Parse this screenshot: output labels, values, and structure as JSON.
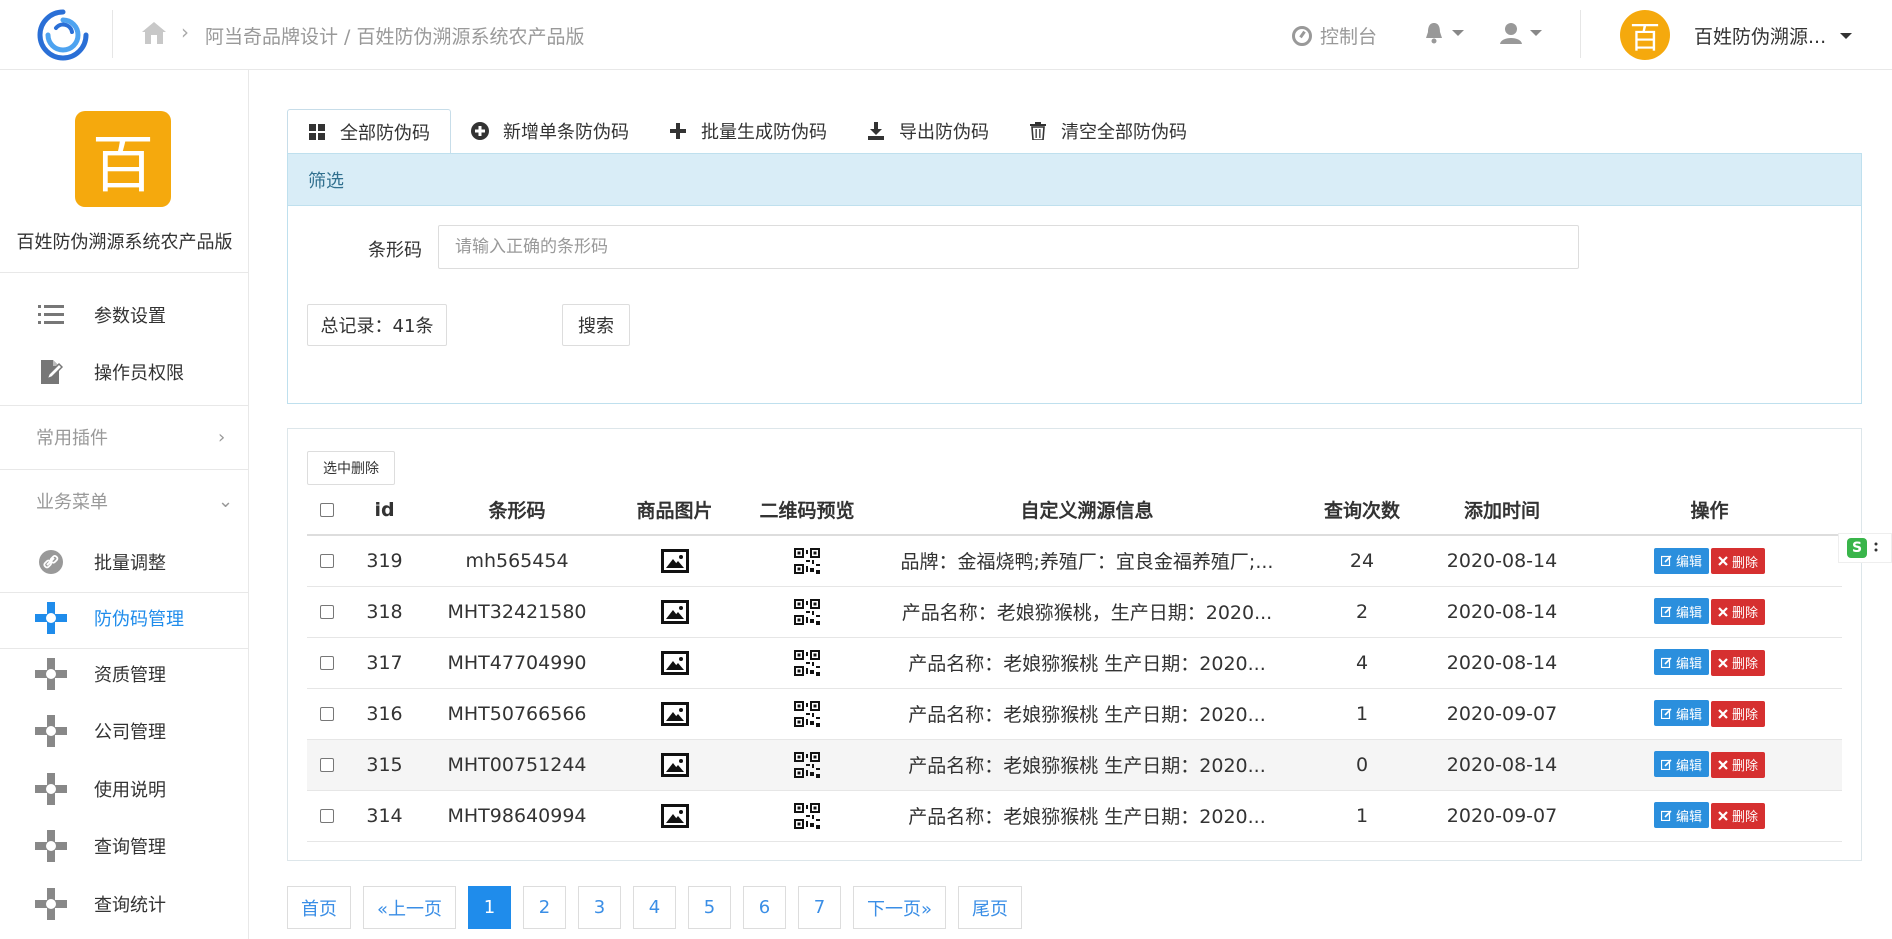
{
  "header": {
    "breadcrumb": "阿当奇品牌设计 / 百姓防伪溯源系统农产品版",
    "console_label": "控制台",
    "user_name": "百姓防伪溯源...",
    "avatar_char": "百"
  },
  "sidebar": {
    "brand_char": "百",
    "brand_name": "百姓防伪溯源系统农产品版",
    "top_items": [
      {
        "label": "参数设置",
        "icon": "list-icon"
      },
      {
        "label": "操作员权限",
        "icon": "edit-doc-icon"
      }
    ],
    "sections": [
      {
        "label": "常用插件",
        "chevron": ">"
      },
      {
        "label": "业务菜单",
        "chevron": "∨"
      }
    ],
    "business_items": [
      {
        "label": "批量调整",
        "icon": "link-icon",
        "active": false
      },
      {
        "label": "防伪码管理",
        "icon": "gear-icon",
        "active": true
      },
      {
        "label": "资质管理",
        "icon": "gear-icon",
        "active": false
      },
      {
        "label": "公司管理",
        "icon": "gear-icon",
        "active": false
      },
      {
        "label": "使用说明",
        "icon": "gear-icon",
        "active": false
      },
      {
        "label": "查询管理",
        "icon": "gear-icon",
        "active": false
      },
      {
        "label": "查询统计",
        "icon": "gear-icon",
        "active": false
      }
    ]
  },
  "tabs": [
    {
      "label": "全部防伪码",
      "icon": "grid-icon",
      "active": true
    },
    {
      "label": "新增单条防伪码",
      "icon": "plus-circle-icon",
      "active": false
    },
    {
      "label": "批量生成防伪码",
      "icon": "plus-icon",
      "active": false
    },
    {
      "label": "导出防伪码",
      "icon": "download-icon",
      "active": false
    },
    {
      "label": "清空全部防伪码",
      "icon": "trash-icon",
      "active": false
    }
  ],
  "filter": {
    "title": "筛选",
    "barcode_label": "条形码",
    "barcode_placeholder": "请输入正确的条形码",
    "barcode_value": "",
    "total_label": "总记录：41条",
    "search_label": "搜索"
  },
  "table": {
    "delete_selected_label": "选中删除",
    "columns": [
      "id",
      "条形码",
      "商品图片",
      "二维码预览",
      "自定义溯源信息",
      "查询次数",
      "添加时间",
      "操作"
    ],
    "edit_label": "编辑",
    "delete_label": "删除",
    "rows": [
      {
        "id": "319",
        "barcode": "mh565454",
        "info": "品牌：金福烧鸭;养殖厂：宜良金福养殖厂;...",
        "count": "24",
        "date": "2020-08-14"
      },
      {
        "id": "318",
        "barcode": "MHT32421580",
        "info": "产品名称：老娘猕猴桃，生产日期：2020...",
        "count": "2",
        "date": "2020-08-14"
      },
      {
        "id": "317",
        "barcode": "MHT47704990",
        "info": "产品名称：老娘猕猴桃 生产日期：2020...",
        "count": "4",
        "date": "2020-08-14"
      },
      {
        "id": "316",
        "barcode": "MHT50766566",
        "info": "产品名称：老娘猕猴桃 生产日期：2020...",
        "count": "1",
        "date": "2020-09-07"
      },
      {
        "id": "315",
        "barcode": "MHT00751244",
        "info": "产品名称：老娘猕猴桃 生产日期：2020...",
        "count": "0",
        "date": "2020-08-14"
      },
      {
        "id": "314",
        "barcode": "MHT98640994",
        "info": "产品名称：老娘猕猴桃 生产日期：2020...",
        "count": "1",
        "date": "2020-09-07"
      }
    ]
  },
  "pagination": {
    "first": "首页",
    "prev": "«上一页",
    "pages": [
      "1",
      "2",
      "3",
      "4",
      "5",
      "6",
      "7"
    ],
    "current": "1",
    "next": "下一页»",
    "last": "尾页"
  },
  "float_widget": {
    "label": "S"
  },
  "colors": {
    "accent": "#1f8ceb",
    "brand": "#f5a90d",
    "danger": "#d63030",
    "filter_head": "#d9edf7"
  }
}
